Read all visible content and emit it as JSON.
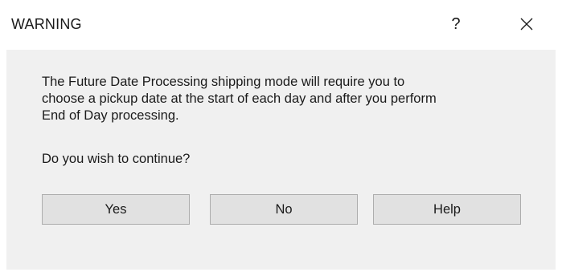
{
  "window": {
    "title": "WARNING",
    "help_label": "?",
    "close_icon": "close-icon"
  },
  "message": {
    "line1": "The Future Date Processing shipping mode will require you to",
    "line2": "choose a pickup date at the start of each day and after you perform",
    "line3": "End of Day processing.",
    "question": "Do you wish to continue?"
  },
  "buttons": {
    "yes": "Yes",
    "no": "No",
    "help": "Help"
  },
  "colors": {
    "body_bg": "#f0f0f0",
    "button_bg": "#e1e1e1",
    "button_border": "#adadad"
  }
}
